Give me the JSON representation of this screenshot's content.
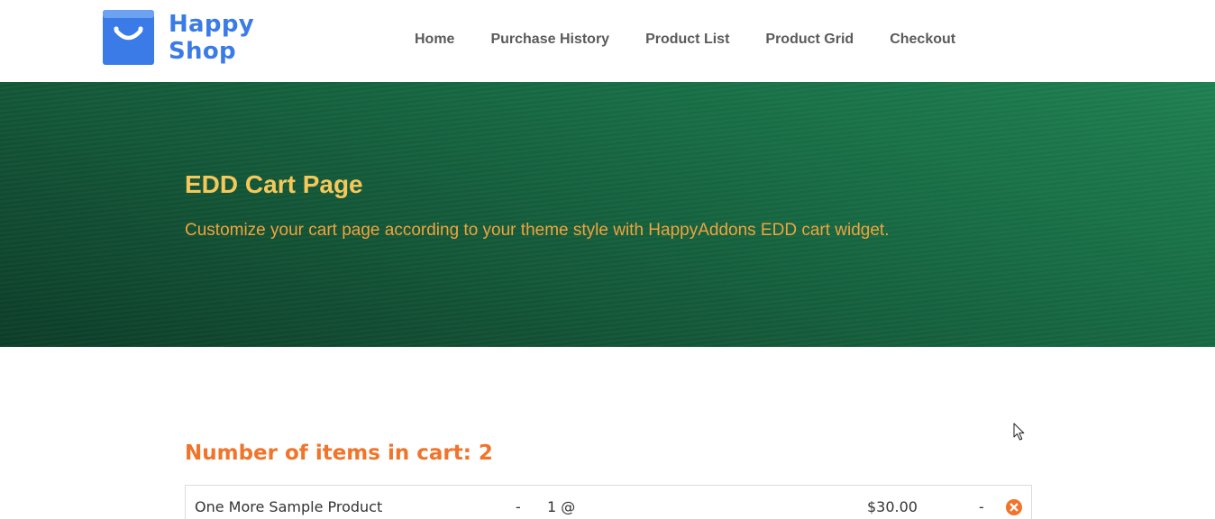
{
  "header": {
    "logo_line1": "Happy",
    "logo_line2": "Shop",
    "nav": [
      "Home",
      "Purchase History",
      "Product List",
      "Product Grid",
      "Checkout"
    ]
  },
  "hero": {
    "title": "EDD Cart Page",
    "subtitle": "Customize your cart page according to your theme style with HappyAddons EDD cart widget."
  },
  "cart": {
    "heading": "Number of items in cart: 2",
    "items": [
      {
        "name": "One More Sample Product",
        "separator": "-",
        "quantity": "1 @",
        "price": "$30.00",
        "separator2": "-"
      }
    ]
  },
  "colors": {
    "brand_blue": "#3a7be8",
    "hero_title": "#f6c85a",
    "hero_subtitle": "#f1a33c",
    "accent_orange": "#f0742a"
  },
  "icons": [
    "shopping-bag-logo-icon",
    "remove-item-icon",
    "mouse-cursor-icon"
  ]
}
